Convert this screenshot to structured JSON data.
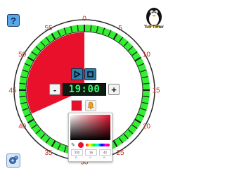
{
  "dial": {
    "labels": [
      "0",
      "5",
      "10",
      "15",
      "20",
      "25",
      "30",
      "35",
      "40",
      "45",
      "50",
      "55"
    ],
    "remaining_minutes": 19
  },
  "colors": {
    "ring": "#33ee33",
    "sector": "#e8102a",
    "tick": "#1a1a1a",
    "label": "#c0392b"
  },
  "display": {
    "time": "19:00"
  },
  "controls": {
    "minus": "-",
    "plus": "+",
    "help": "?"
  },
  "logo": {
    "text": "Tux Timer"
  },
  "icons": {
    "play": "play-icon",
    "stop": "stop-icon",
    "bell": "bell-icon",
    "settings": "gear-icon",
    "logo": "penguin-icon",
    "picker": "eyedropper-icon"
  },
  "picker": {
    "values": [
      "232",
      "16",
      "42"
    ],
    "labels": [
      "R",
      "G",
      "B"
    ]
  }
}
